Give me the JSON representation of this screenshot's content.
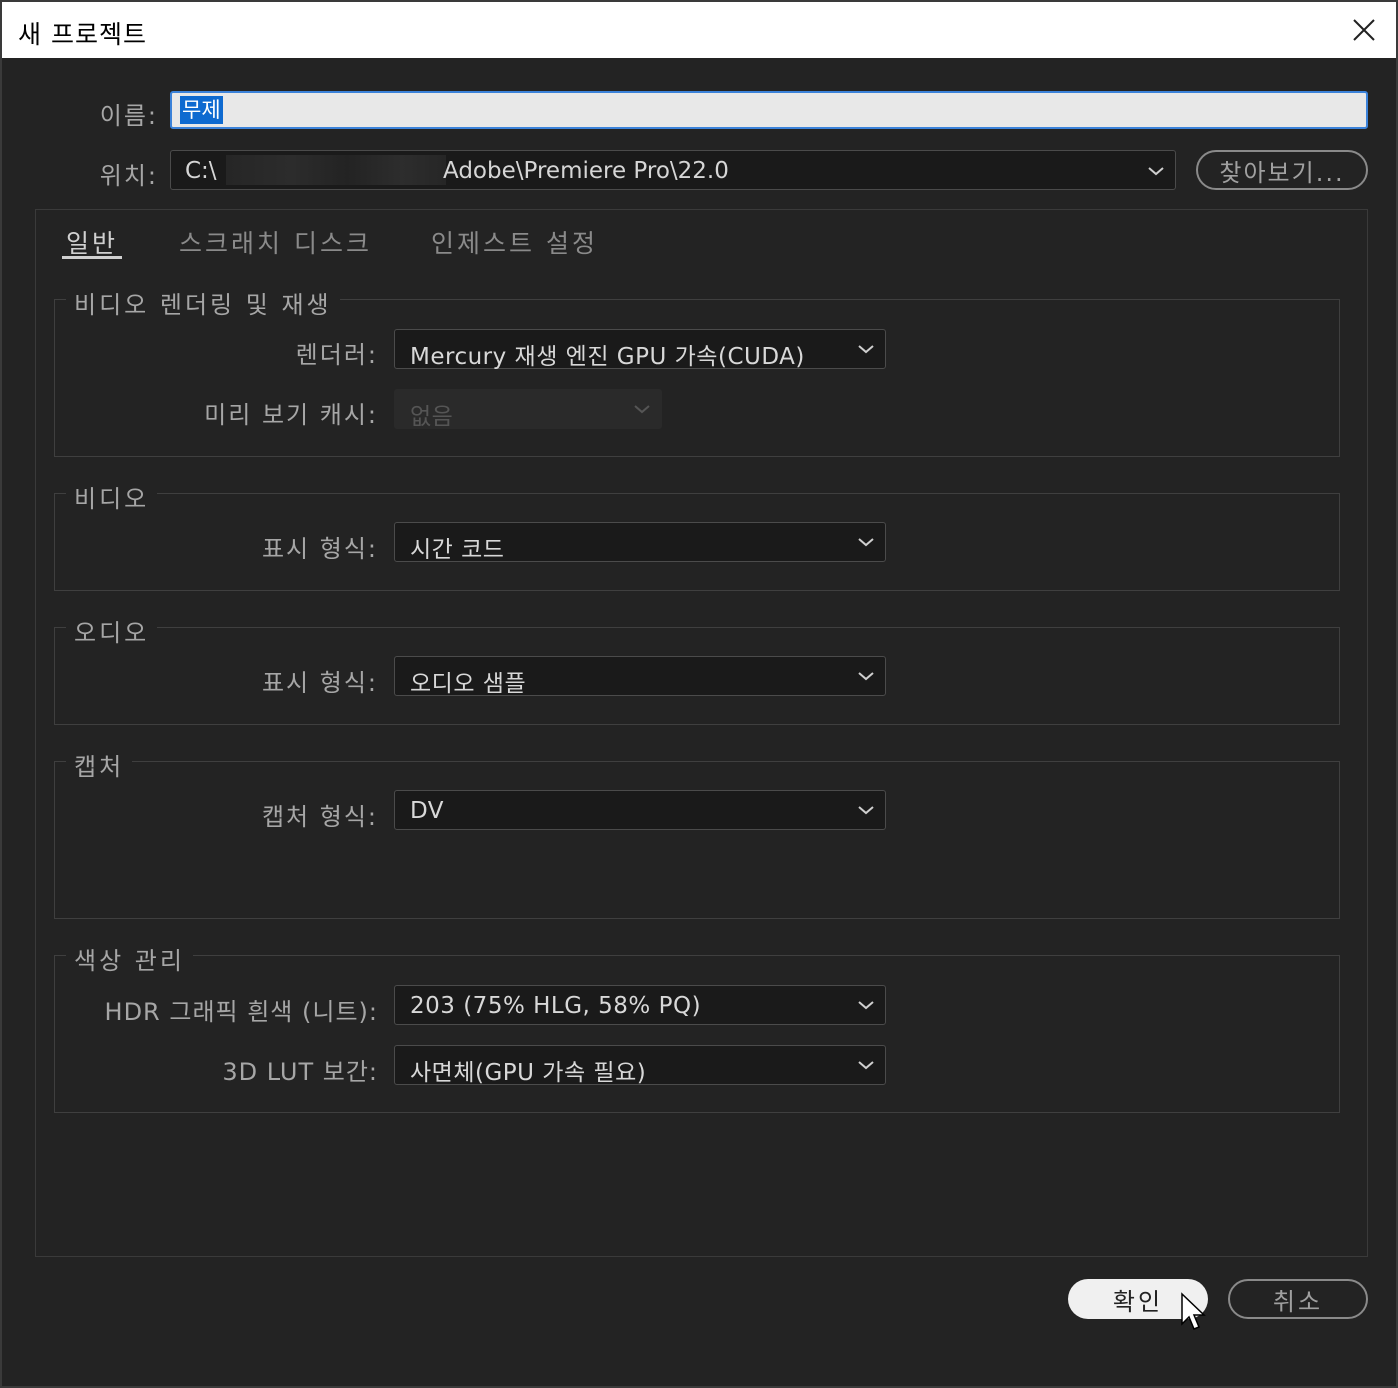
{
  "window": {
    "title": "새 프로젝트"
  },
  "name_field": {
    "label": "이름:",
    "value": "무제"
  },
  "location_field": {
    "label": "위치:",
    "value_prefix": "C:\\",
    "value_suffix": "Adobe\\Premiere Pro\\22.0",
    "browse_label": "찾아보기..."
  },
  "tabs": [
    {
      "label": "일반",
      "active": true
    },
    {
      "label": "스크래치 디스크",
      "active": false
    },
    {
      "label": "인제스트 설정",
      "active": false
    }
  ],
  "groups": {
    "video_rendering": {
      "title": "비디오 렌더링 및 재생",
      "renderer_label": "렌더러:",
      "renderer_value": "Mercury 재생 엔진 GPU 가속(CUDA)",
      "preview_cache_label": "미리 보기 캐시:",
      "preview_cache_value": "없음"
    },
    "video": {
      "title": "비디오",
      "display_format_label": "표시 형식:",
      "display_format_value": "시간 코드"
    },
    "audio": {
      "title": "오디오",
      "display_format_label": "표시 형식:",
      "display_format_value": "오디오 샘플"
    },
    "capture": {
      "title": "캡처",
      "capture_format_label": "캡처 형식:",
      "capture_format_value": "DV"
    },
    "color": {
      "title": "색상 관리",
      "hdr_label": "HDR 그래픽 흰색 (니트):",
      "hdr_value": "203 (75% HLG, 58% PQ)",
      "lut_label": "3D LUT 보간:",
      "lut_value": "사면체(GPU 가속 필요)"
    }
  },
  "buttons": {
    "ok": "확인",
    "cancel": "취소"
  },
  "colors": {
    "selection": "#0e6ad0",
    "focus_border": "#3b82d9",
    "dialog_bg": "#232323"
  }
}
